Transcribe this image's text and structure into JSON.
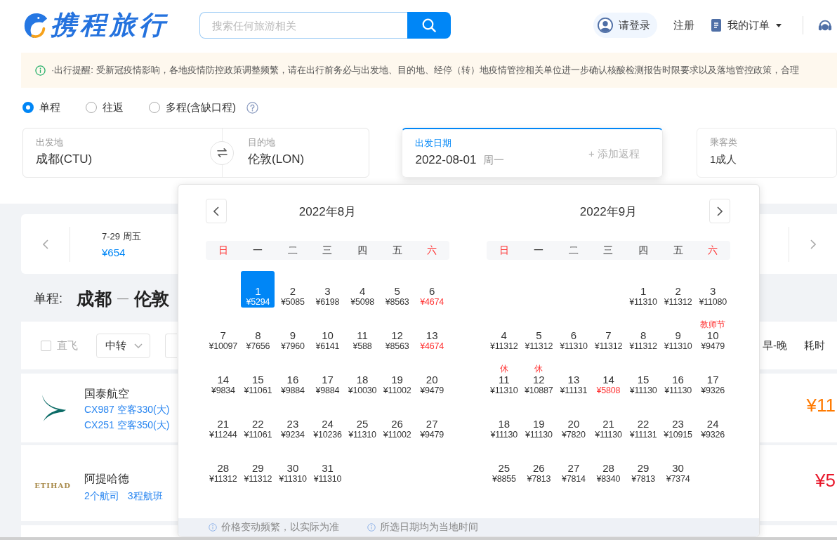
{
  "header": {
    "logo_text": "携程旅行",
    "search": {
      "placeholder": "搜索任何旅游相关"
    },
    "login": "请登录",
    "register": "注册",
    "orders": "我的订单"
  },
  "notice": "·出行提醒: 受新冠疫情影响，各地疫情防控政策调整频繁，请在出行前务必与出发地、目的地、经停（转）地疫情管控相关单位进一步确认核酸检测报告时限要求以及落地管控政策，合理",
  "trip_types": [
    {
      "label": "单程",
      "selected": true
    },
    {
      "label": "往返",
      "selected": false
    },
    {
      "label": "多程(含缺口程)",
      "selected": false
    }
  ],
  "search_form": {
    "departure": {
      "label": "出发地",
      "value": "成都(CTU)"
    },
    "destination": {
      "label": "目的地",
      "value": "伦敦(LON)"
    },
    "date": {
      "label": "出发日期",
      "value": "2022-08-01",
      "weekday": "周一",
      "focused": true,
      "add_return": "+ 添加返程"
    },
    "passengers": {
      "label": "乘客类",
      "value": "1成人"
    }
  },
  "date_strip": {
    "dates": [
      {
        "date": "7-29 周五",
        "price": "¥654"
      }
    ]
  },
  "route": {
    "trip": "单程:",
    "from": "成都",
    "separator": "—",
    "to": "伦敦"
  },
  "filters": {
    "direct": {
      "label": "直飞",
      "checked": false,
      "disabled": true
    },
    "transfer": {
      "label": "中转"
    },
    "sorts": [
      "早-晚",
      "耗时"
    ]
  },
  "flights": [
    {
      "kind": "stacked",
      "airline": "国泰航空",
      "logo": {
        "kind": "swoosh"
      },
      "details": [
        "CX987 空客330(大)",
        "CX251 空客350(大)"
      ],
      "price": "¥11",
      "lowest": false
    },
    {
      "kind": "inline",
      "airline": "阿提哈德",
      "logo": {
        "kind": "wordmark",
        "text": "ETIHAD"
      },
      "details": [
        "2个航司",
        "3程航班"
      ],
      "price": "¥5",
      "lowest": true
    }
  ],
  "calendar": {
    "months": [
      {
        "title": "2022年8月",
        "prev_button": true,
        "next_button": false,
        "weekdays": [
          {
            "label": "日",
            "weekend": true
          },
          {
            "label": "一",
            "weekend": false
          },
          {
            "label": "二",
            "weekend": false
          },
          {
            "label": "三",
            "weekend": false
          },
          {
            "label": "四",
            "weekend": false
          },
          {
            "label": "五",
            "weekend": false
          },
          {
            "label": "六",
            "weekend": true
          }
        ],
        "weeks": [
          [
            {
              "kind": "blank"
            },
            {
              "kind": "day",
              "day": "1",
              "price": "¥5294",
              "selected": true,
              "lowest": false
            },
            {
              "kind": "day",
              "day": "2",
              "price": "¥5085",
              "selected": false,
              "lowest": false
            },
            {
              "kind": "day",
              "day": "3",
              "price": "¥6198",
              "selected": false,
              "lowest": false
            },
            {
              "kind": "day",
              "day": "4",
              "price": "¥5098",
              "selected": false,
              "lowest": false
            },
            {
              "kind": "day",
              "day": "5",
              "price": "¥8563",
              "selected": false,
              "lowest": false
            },
            {
              "kind": "day",
              "day": "6",
              "price": "¥4674",
              "selected": false,
              "lowest": true
            }
          ],
          [
            {
              "kind": "day",
              "day": "7",
              "price": "¥10097",
              "selected": false,
              "lowest": false
            },
            {
              "kind": "day",
              "day": "8",
              "price": "¥7656",
              "selected": false,
              "lowest": false
            },
            {
              "kind": "day",
              "day": "9",
              "price": "¥7960",
              "selected": false,
              "lowest": false
            },
            {
              "kind": "day",
              "day": "10",
              "price": "¥6141",
              "selected": false,
              "lowest": false
            },
            {
              "kind": "day",
              "day": "11",
              "price": "¥588",
              "selected": false,
              "lowest": false
            },
            {
              "kind": "day",
              "day": "12",
              "price": "¥8563",
              "selected": false,
              "lowest": false
            },
            {
              "kind": "day",
              "day": "13",
              "price": "¥4674",
              "selected": false,
              "lowest": true
            }
          ],
          [
            {
              "kind": "day",
              "day": "14",
              "price": "¥9834",
              "selected": false,
              "lowest": false
            },
            {
              "kind": "day",
              "day": "15",
              "price": "¥11061",
              "selected": false,
              "lowest": false
            },
            {
              "kind": "day",
              "day": "16",
              "price": "¥9884",
              "selected": false,
              "lowest": false
            },
            {
              "kind": "day",
              "day": "17",
              "price": "¥9884",
              "selected": false,
              "lowest": false
            },
            {
              "kind": "day",
              "day": "18",
              "price": "¥10030",
              "selected": false,
              "lowest": false
            },
            {
              "kind": "day",
              "day": "19",
              "price": "¥11002",
              "selected": false,
              "lowest": false
            },
            {
              "kind": "day",
              "day": "20",
              "price": "¥9479",
              "selected": false,
              "lowest": false
            }
          ],
          [
            {
              "kind": "day",
              "day": "21",
              "price": "¥11244",
              "selected": false,
              "lowest": false
            },
            {
              "kind": "day",
              "day": "22",
              "price": "¥11061",
              "selected": false,
              "lowest": false
            },
            {
              "kind": "day",
              "day": "23",
              "price": "¥9234",
              "selected": false,
              "lowest": false
            },
            {
              "kind": "day",
              "day": "24",
              "price": "¥10236",
              "selected": false,
              "lowest": false
            },
            {
              "kind": "day",
              "day": "25",
              "price": "¥11310",
              "selected": false,
              "lowest": false
            },
            {
              "kind": "day",
              "day": "26",
              "price": "¥11002",
              "selected": false,
              "lowest": false
            },
            {
              "kind": "day",
              "day": "27",
              "price": "¥9479",
              "selected": false,
              "lowest": false
            }
          ],
          [
            {
              "kind": "day",
              "day": "28",
              "price": "¥11312",
              "selected": false,
              "lowest": false
            },
            {
              "kind": "day",
              "day": "29",
              "price": "¥11312",
              "selected": false,
              "lowest": false
            },
            {
              "kind": "day",
              "day": "30",
              "price": "¥11310",
              "selected": false,
              "lowest": false
            },
            {
              "kind": "day",
              "day": "31",
              "price": "¥11310",
              "selected": false,
              "lowest": false
            }
          ]
        ]
      },
      {
        "title": "2022年9月",
        "prev_button": false,
        "next_button": true,
        "weekdays": [
          {
            "label": "日",
            "weekend": true
          },
          {
            "label": "一",
            "weekend": false
          },
          {
            "label": "二",
            "weekend": false
          },
          {
            "label": "三",
            "weekend": false
          },
          {
            "label": "四",
            "weekend": false
          },
          {
            "label": "五",
            "weekend": false
          },
          {
            "label": "六",
            "weekend": true
          }
        ],
        "weeks": [
          [
            {
              "kind": "blank"
            },
            {
              "kind": "blank"
            },
            {
              "kind": "blank"
            },
            {
              "kind": "blank"
            },
            {
              "kind": "day",
              "day": "1",
              "price": "¥11310",
              "selected": false,
              "lowest": false
            },
            {
              "kind": "day",
              "day": "2",
              "price": "¥11312",
              "selected": false,
              "lowest": false
            },
            {
              "kind": "day",
              "day": "3",
              "price": "¥11080",
              "selected": false,
              "lowest": false
            }
          ],
          [
            {
              "kind": "day",
              "day": "4",
              "price": "¥11312",
              "selected": false,
              "lowest": false
            },
            {
              "kind": "day",
              "day": "5",
              "price": "¥11312",
              "selected": false,
              "lowest": false
            },
            {
              "kind": "day",
              "day": "6",
              "price": "¥11310",
              "selected": false,
              "lowest": false
            },
            {
              "kind": "day",
              "day": "7",
              "price": "¥11312",
              "selected": false,
              "lowest": false
            },
            {
              "kind": "day",
              "day": "8",
              "price": "¥11312",
              "selected": false,
              "lowest": false
            },
            {
              "kind": "day",
              "day": "9",
              "price": "¥11310",
              "selected": false,
              "lowest": false
            },
            {
              "kind": "day",
              "day": "10",
              "price": "¥9479",
              "selected": false,
              "lowest": false,
              "note": "教师节"
            }
          ],
          [
            {
              "kind": "day",
              "day": "11",
              "price": "¥11310",
              "selected": false,
              "lowest": false,
              "note": "休"
            },
            {
              "kind": "day",
              "day": "12",
              "price": "¥10887",
              "selected": false,
              "lowest": false,
              "note": "休"
            },
            {
              "kind": "day",
              "day": "13",
              "price": "¥11131",
              "selected": false,
              "lowest": false
            },
            {
              "kind": "day",
              "day": "14",
              "price": "¥5808",
              "selected": false,
              "lowest": true
            },
            {
              "kind": "day",
              "day": "15",
              "price": "¥11130",
              "selected": false,
              "lowest": false
            },
            {
              "kind": "day",
              "day": "16",
              "price": "¥11130",
              "selected": false,
              "lowest": false
            },
            {
              "kind": "day",
              "day": "17",
              "price": "¥9326",
              "selected": false,
              "lowest": false
            }
          ],
          [
            {
              "kind": "day",
              "day": "18",
              "price": "¥11130",
              "selected": false,
              "lowest": false
            },
            {
              "kind": "day",
              "day": "19",
              "price": "¥11130",
              "selected": false,
              "lowest": false
            },
            {
              "kind": "day",
              "day": "20",
              "price": "¥7820",
              "selected": false,
              "lowest": false
            },
            {
              "kind": "day",
              "day": "21",
              "price": "¥11130",
              "selected": false,
              "lowest": false
            },
            {
              "kind": "day",
              "day": "22",
              "price": "¥11131",
              "selected": false,
              "lowest": false
            },
            {
              "kind": "day",
              "day": "23",
              "price": "¥10915",
              "selected": false,
              "lowest": false
            },
            {
              "kind": "day",
              "day": "24",
              "price": "¥9326",
              "selected": false,
              "lowest": false
            }
          ],
          [
            {
              "kind": "day",
              "day": "25",
              "price": "¥8855",
              "selected": false,
              "lowest": false
            },
            {
              "kind": "day",
              "day": "26",
              "price": "¥7813",
              "selected": false,
              "lowest": false
            },
            {
              "kind": "day",
              "day": "27",
              "price": "¥7814",
              "selected": false,
              "lowest": false
            },
            {
              "kind": "day",
              "day": "28",
              "price": "¥8340",
              "selected": false,
              "lowest": false
            },
            {
              "kind": "day",
              "day": "29",
              "price": "¥7813",
              "selected": false,
              "lowest": false
            },
            {
              "kind": "day",
              "day": "30",
              "price": "¥7374",
              "selected": false,
              "lowest": false
            }
          ]
        ]
      }
    ],
    "notes": [
      "价格变动频繁，以实际为准",
      "所选日期均为当地时间"
    ]
  }
}
